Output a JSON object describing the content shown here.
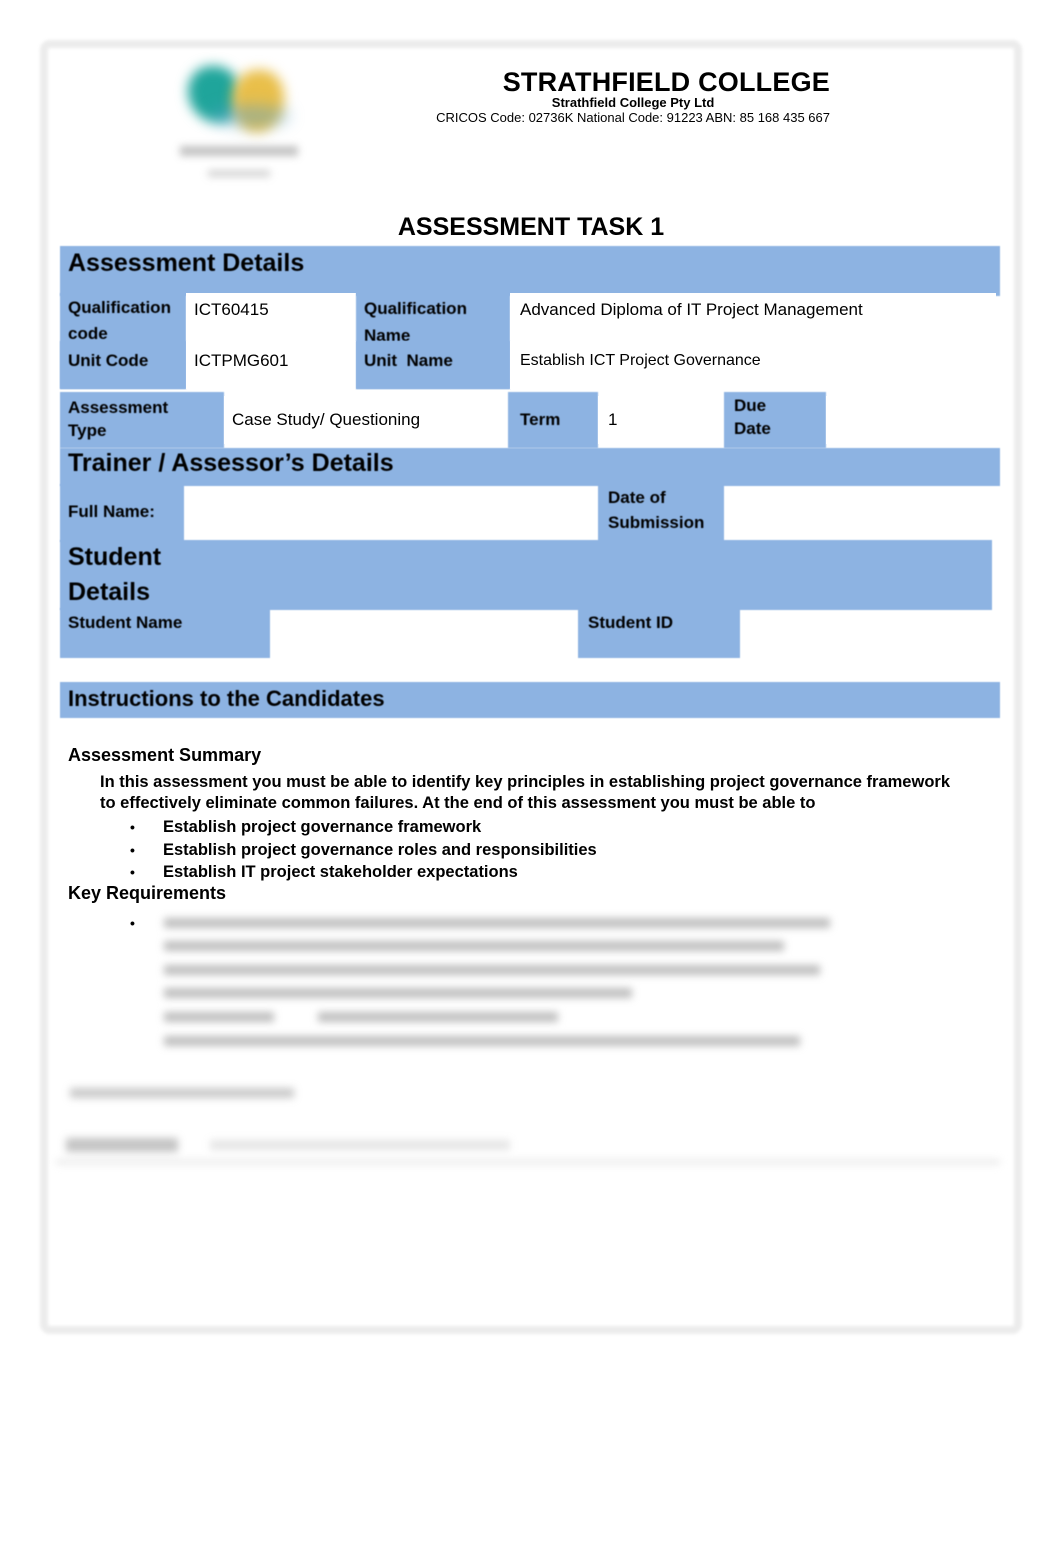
{
  "header": {
    "college_name": "STRATHFIELD COLLEGE",
    "company": "Strathfield College Pty Ltd",
    "codes_line": "CRICOS Code: 02736K National Code: 91223 ABN: 85 168 435 667"
  },
  "logo": {
    "icon": "college-logo"
  },
  "document_title": "ASSESSMENT TASK 1",
  "assessment_details": {
    "heading": "Assessment Details",
    "qualification_code_label": "Qualification code",
    "qualification_code_label_line1": "Qualification",
    "qualification_code_label_line2": "code",
    "qualification_code": "ICT60415",
    "qualification_name_label_line1": "Qualification",
    "qualification_name_label_line2": "Name",
    "qualification_name": "Advanced Diploma of IT Project Management",
    "unit_code_label": "Unit Code",
    "unit_code": "ICTPMG601",
    "unit_name_label": "Unit  Name",
    "unit_name": "Establish ICT Project Governance",
    "assessment_type_label_line1": "Assessment",
    "assessment_type_label_line2": "Type",
    "assessment_type": "Case Study/ Questioning",
    "term_label": "Term",
    "term": "1",
    "due_date_label_line1": "Due",
    "due_date_label_line2": "Date",
    "due_date": ""
  },
  "trainer_details": {
    "heading": "Trainer / Assessor’s Details",
    "full_name_label": "Full Name:",
    "full_name": "",
    "date_of_submission_label_line1": "Date of",
    "date_of_submission_label_line2": "Submission",
    "date_of_submission": ""
  },
  "student_details": {
    "heading_line1": "Student",
    "heading_line2": "Details",
    "student_name_label": "Student Name",
    "student_name": "",
    "student_id_label": "Student ID",
    "student_id": ""
  },
  "instructions": {
    "heading": "Instructions to the Candidates",
    "summary_heading": "Assessment Summary",
    "summary_text": "In this assessment you must be able to identify key principles in establishing project governance framework to effectively eliminate common failures. At the end of this assessment you must be able to",
    "outcomes": [
      "Establish project governance framework",
      "Establish project governance roles and responsibilities",
      "Establish IT project stakeholder expectations"
    ],
    "key_requirements_heading": "Key Requirements",
    "bullet_glyph": "•"
  },
  "colors": {
    "section_blue": "#8db3e2",
    "logo_teal": "#1fa59b",
    "logo_yellow": "#e9bf4a"
  }
}
